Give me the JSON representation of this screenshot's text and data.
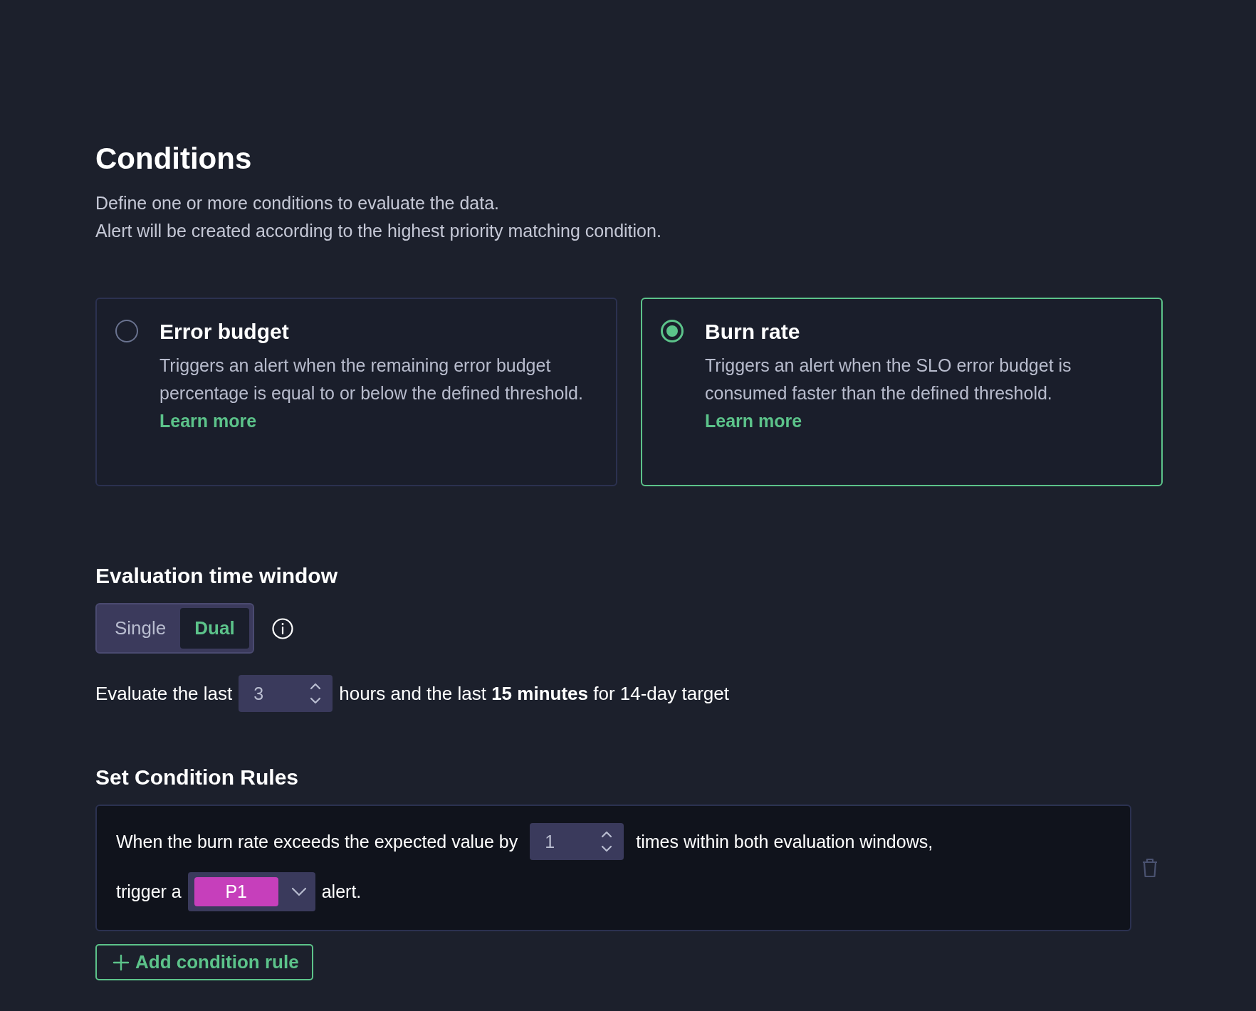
{
  "section": {
    "title": "Conditions",
    "description": [
      "Define one or more conditions to evaluate the data.",
      "Alert will be created according to the highest priority matching condition."
    ]
  },
  "condition_types": [
    {
      "title": "Error budget",
      "description": "Triggers an alert when the remaining error budget percentage is equal to or below the defined threshold.",
      "link": "Learn more",
      "selected": false
    },
    {
      "title": "Burn rate",
      "description": "Triggers an alert when the SLO error budget is consumed faster than the defined threshold.",
      "link": "Learn more",
      "selected": true
    }
  ],
  "evaluation": {
    "heading": "Evaluation time window",
    "modes": [
      {
        "label": "Single",
        "selected": false
      },
      {
        "label": "Dual",
        "selected": true
      }
    ],
    "lead": "Evaluate the last",
    "value": "3",
    "tail": "hours and the last **15 minutes** for 14-day target"
  },
  "rules": {
    "heading": "Set Condition Rules",
    "items": [
      {
        "lead": "When the burn rate exceeds the expected value by",
        "value": "1",
        "middle": "times within both evaluation windows,",
        "trigger": "trigger a",
        "priority": "P1",
        "color": "#c63fbb",
        "tail": "alert."
      }
    ],
    "add_button": "Add condition rule"
  }
}
